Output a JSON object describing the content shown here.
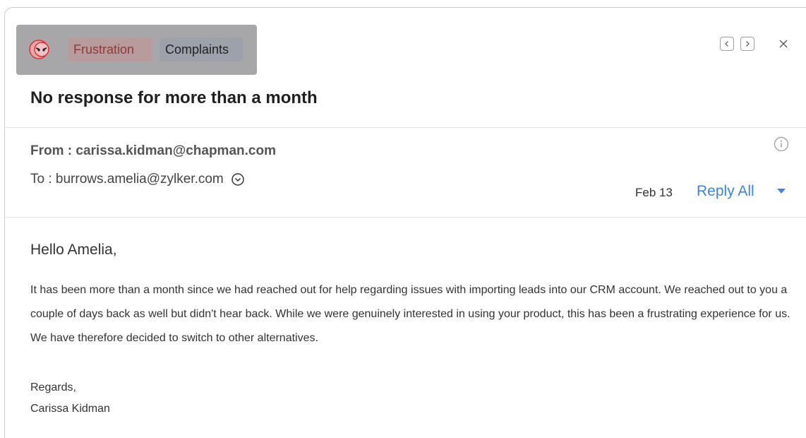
{
  "tags": [
    {
      "label": "Frustration"
    },
    {
      "label": "Complaints"
    }
  ],
  "email": {
    "subject": "No response for more than a month",
    "from_label": "From : carissa.kidman@chapman.com",
    "to_label": "To : burrows.amelia@zylker.com",
    "date": "Feb 13",
    "reply_all_label": "Reply All",
    "greeting": "Hello Amelia,",
    "body": "It has been more than a month since we had reached out for help regarding issues with importing leads into our CRM account. We reached out to you a couple of days back as well but didn't hear back. While we were genuinely interested in using your product, this has been a frustrating experience for us. We have therefore decided to switch to other alternatives.",
    "closing": "Regards,",
    "signature": "Carissa Kidman"
  },
  "icons": {
    "emotion": "angry-face-icon",
    "prev": "chevron-left-icon",
    "next": "chevron-right-icon",
    "close": "close-icon",
    "info": "info-icon",
    "expand": "chevron-down-circle-icon",
    "reply_menu": "caret-down-icon"
  },
  "colors": {
    "accent": "#3b82f6",
    "frustration_tag_bg": "#b89b9c",
    "frustration_tag_text": "#8c3b3b",
    "complaints_tag_bg": "#9da2aa"
  }
}
